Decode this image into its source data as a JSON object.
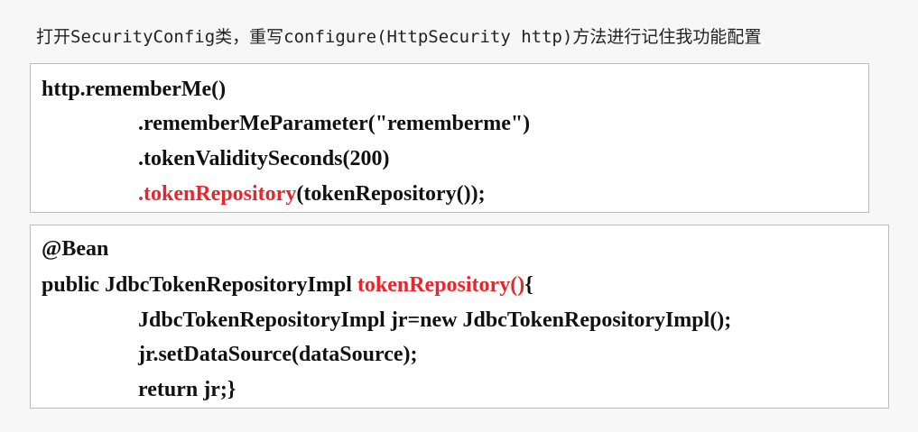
{
  "caption": "打开SecurityConfig类，重写configure(HttpSecurity http)方法进行记住我功能配置",
  "colors": {
    "highlight": "#e8262b",
    "code_text": "#111111",
    "box_border": "#bdbdbd",
    "page_background": "#f7f7f7"
  },
  "block1": {
    "line1": "http.rememberMe()",
    "line2": ".rememberMeParameter(\"rememberme\")",
    "line3": ".tokenValiditySeconds(200)",
    "line4": {
      "dot": ".",
      "method": "tokenRepository",
      "rest": "(tokenRepository());"
    }
  },
  "block2": {
    "line1": "@Bean",
    "line2": {
      "prefix": "public JdbcTokenRepositoryImpl ",
      "method": "tokenRepository",
      "paren": "()",
      "brace": "{"
    },
    "line3": "JdbcTokenRepositoryImpl jr=new JdbcTokenRepositoryImpl();",
    "line4": "jr.setDataSource(dataSource);",
    "line5": "return jr;}"
  }
}
